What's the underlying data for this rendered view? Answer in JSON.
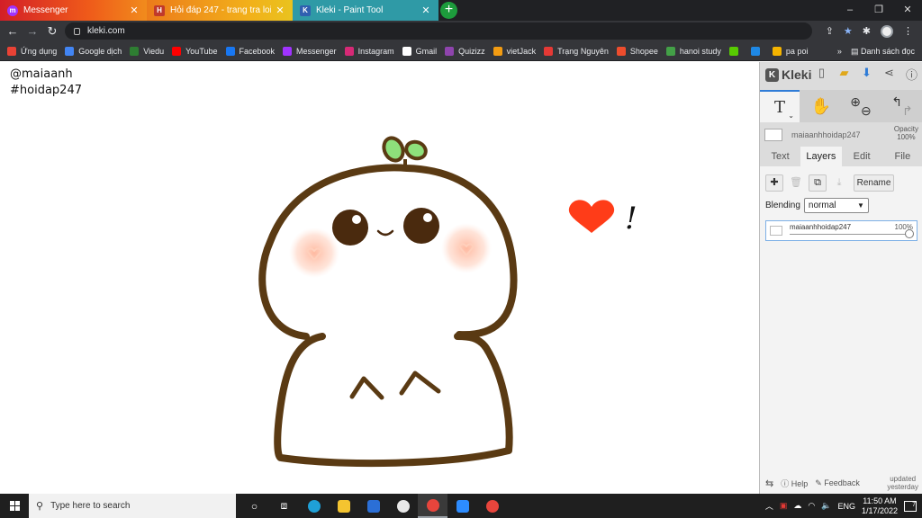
{
  "tabs": [
    {
      "label": "Messenger",
      "close": "✕"
    },
    {
      "label": "Hỏi đáp 247 - trang tra loi",
      "close": "✕"
    },
    {
      "label": "Kleki - Paint Tool",
      "close": "✕"
    }
  ],
  "new_tab": "+",
  "window_controls": {
    "minimize": "–",
    "maximize": "❐",
    "close": "✕"
  },
  "address": {
    "url": "kleki.com"
  },
  "bookmarks": [
    {
      "label": "Ứng dụng",
      "color": "#e94235"
    },
    {
      "label": "Google dịch",
      "color": "#4285f4"
    },
    {
      "label": "Viedu",
      "color": "#2e7d32"
    },
    {
      "label": "YouTube",
      "color": "#ff0000"
    },
    {
      "label": "Facebook",
      "color": "#1877f2"
    },
    {
      "label": "Messenger",
      "color": "#a033ff"
    },
    {
      "label": "Instagram",
      "color": "#d62976"
    },
    {
      "label": "Gmail",
      "color": "#ffffff"
    },
    {
      "label": "Quizizz",
      "color": "#8e44ad"
    },
    {
      "label": "vietJack",
      "color": "#f39c12"
    },
    {
      "label": "Trạng Nguyên",
      "color": "#e53935"
    },
    {
      "label": "Shopee",
      "color": "#ee4d2d"
    },
    {
      "label": "hanoi study",
      "color": "#43a047"
    },
    {
      "label": "",
      "color": "#58cc02"
    },
    {
      "label": "",
      "color": "#1e88e5"
    },
    {
      "label": "pa poi",
      "color": "#f5b400"
    }
  ],
  "bookmarks_more": "»",
  "reading_list": "Danh sách đọc",
  "canvas": {
    "caption_line1": "@maiaanh",
    "caption_line2": "#hoidap247",
    "exclaim": "!"
  },
  "kleki": {
    "logo": "Kleki",
    "layer_name": "maiaanhhoidap247",
    "opacity_label": "Opacity",
    "opacity_value": "100%",
    "tabs": [
      "Text",
      "Layers",
      "Edit",
      "File"
    ],
    "active_tab": "Layers",
    "rename": "Rename",
    "blending_label": "Blending",
    "blending_value": "normal",
    "layer_item": {
      "name": "maiaanhhoidap247",
      "opacity": "100%"
    },
    "footer": {
      "help": "Help",
      "feedback": "Feedback",
      "updated_1": "updated",
      "updated_2": "yesterday"
    },
    "tool_text_glyph": "T"
  },
  "taskbar": {
    "search_placeholder": "Type here to search",
    "lang": "ENG",
    "time": "11:50 AM",
    "date": "1/17/2022",
    "notification_count": "7"
  }
}
